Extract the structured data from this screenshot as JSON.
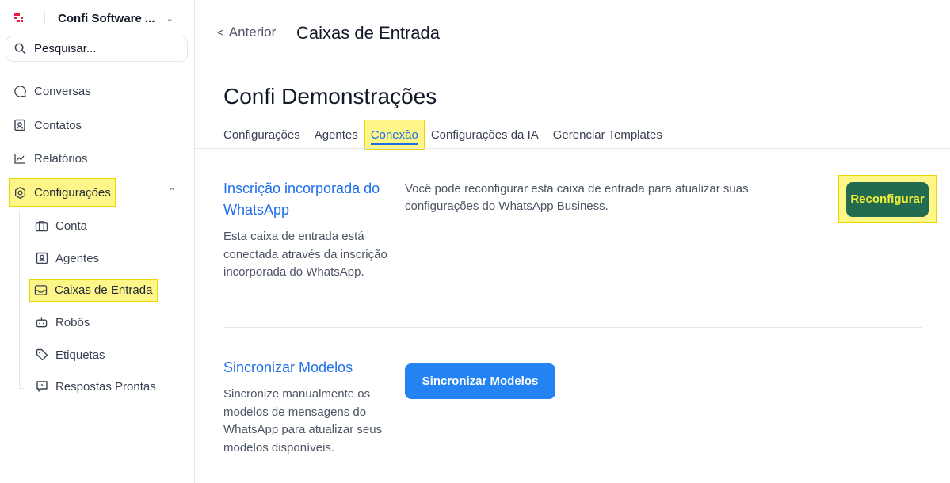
{
  "sidebar": {
    "org_name": "Confi Software ...",
    "search_placeholder": "Pesquisar...",
    "nav": {
      "conversas": "Conversas",
      "contatos": "Contatos",
      "relatorios": "Relatórios",
      "configuracoes": "Configurações"
    },
    "sub": {
      "conta": "Conta",
      "agentes": "Agentes",
      "caixas": "Caixas de Entrada",
      "robos": "Robôs",
      "etiquetas": "Etiquetas",
      "respostas": "Respostas Prontas"
    }
  },
  "header": {
    "back_label": "Anterior",
    "title": "Caixas de Entrada"
  },
  "inbox": {
    "name": "Confi Demonstrações",
    "tabs": [
      "Configurações",
      "Agentes",
      "Conexão",
      "Configurações da IA",
      "Gerenciar Templates"
    ],
    "active_tab": "Conexão"
  },
  "whatsapp_section": {
    "title": "Inscrição incorporada do WhatsApp",
    "desc": "Esta caixa de entrada está conectada através da inscrição incorporada do WhatsApp.",
    "info": "Você pode reconfigurar esta caixa de entrada para atualizar suas configurações do WhatsApp Business.",
    "button": "Reconfigurar"
  },
  "sync_section": {
    "title": "Sincronizar Modelos",
    "desc": "Sincronize manualmente os modelos de mensagens do WhatsApp para atualizar seus modelos disponíveis.",
    "button": "Sincronizar Modelos"
  },
  "colors": {
    "highlight": "#fff68a",
    "accent": "#1f6feb",
    "reconfigure_bg": "#226b4f",
    "sync_bg": "#2383f2"
  }
}
